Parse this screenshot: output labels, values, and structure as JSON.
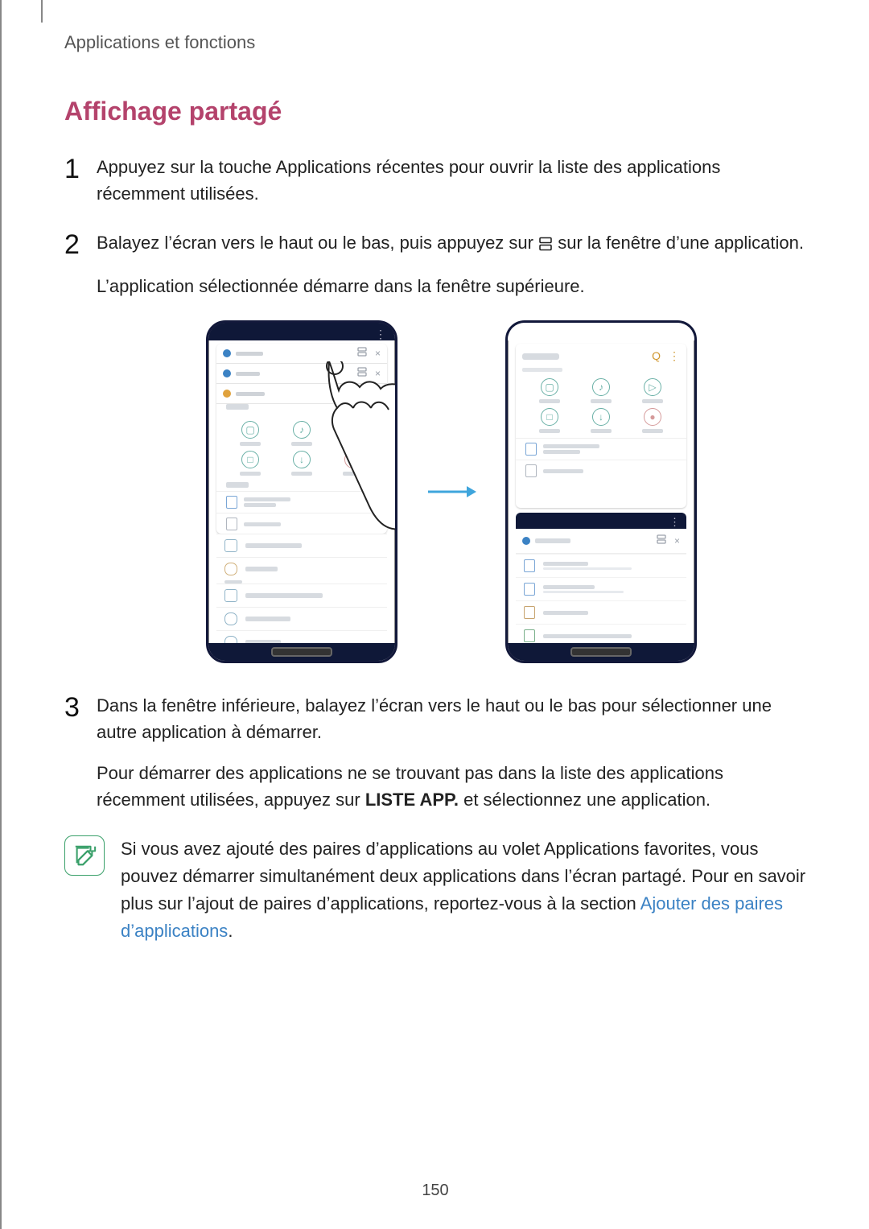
{
  "header": {
    "breadcrumb": "Applications et fonctions"
  },
  "section": {
    "title": "Affichage partagé"
  },
  "steps": {
    "s1": "Appuyez sur la touche Applications récentes pour ouvrir la liste des applications récemment utilisées.",
    "s2a": "Balayez l’écran vers le haut ou le bas, puis appuyez sur ",
    "s2b": " sur la fenêtre d’une application.",
    "s2_sub": "L’application sélectionnée démarre dans la fenêtre supérieure.",
    "s3": "Dans la fenêtre inférieure, balayez l’écran vers le haut ou le bas pour sélectionner une autre application à démarrer.",
    "s3_sub_a": "Pour démarrer des applications ne se trouvant pas dans la liste des applications récemment utilisées, appuyez sur ",
    "s3_sub_bold": "LISTE APP.",
    "s3_sub_b": " et sélectionnez une application."
  },
  "note": {
    "text_a": "Si vous avez ajouté des paires d’applications au volet Applications favorites, vous pouvez démarrer simultanément deux applications dans l’écran partagé. Pour en savoir plus sur l’ajout de paires d’applications, reportez-vous à la section ",
    "link": "Ajouter des paires d’applications",
    "text_b": "."
  },
  "page_number": "150",
  "icons": {
    "split_view": "split-view-icon",
    "search": "Q",
    "more": "⋮",
    "close": "×"
  }
}
